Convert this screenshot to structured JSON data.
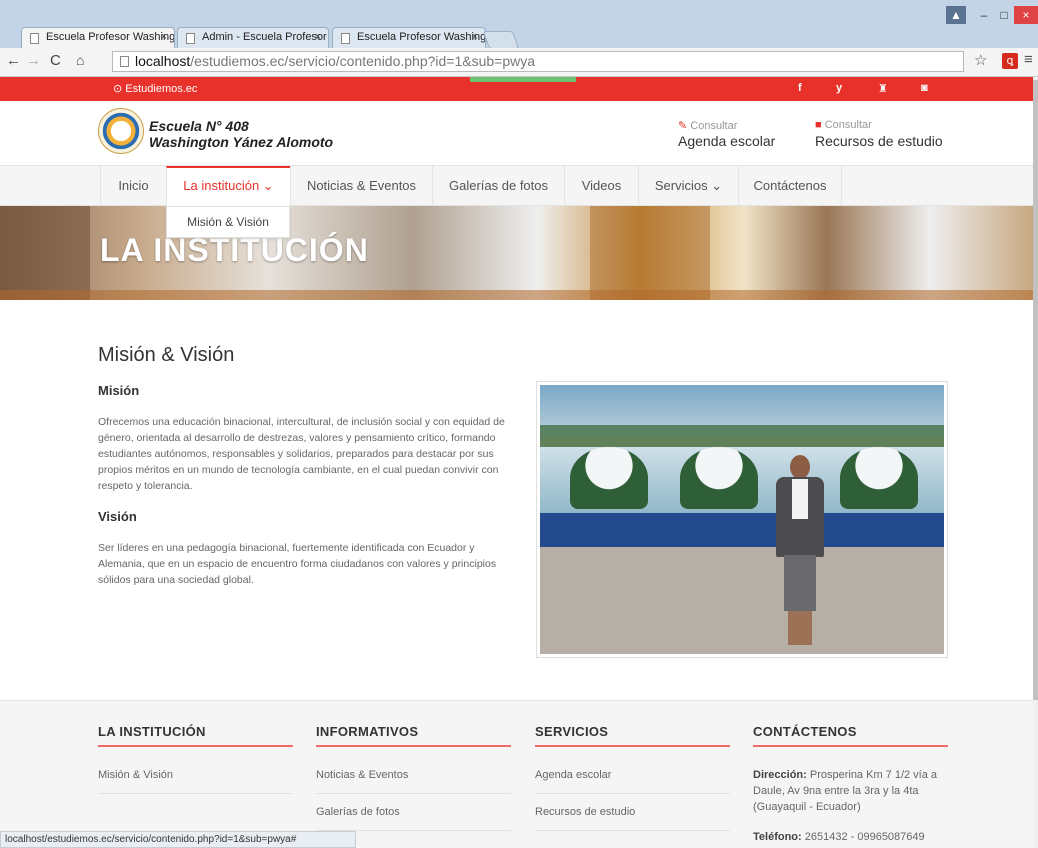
{
  "browser": {
    "tabs": [
      {
        "label": "Escuela Profesor Washing"
      },
      {
        "label": "Admin - Escuela Profesor"
      },
      {
        "label": "Escuela Profesor Washing"
      }
    ],
    "tab_close": "×",
    "url_host": "localhost",
    "url_path": "/estudiemos.ec/servicio/contenido.php?id=1&sub=pwya",
    "status_url": "localhost/estudiemos.ec/servicio/contenido.php?id=1&sub=pwya#",
    "acrobat_glyph": "ꝗ"
  },
  "topbar": {
    "brand": "Estudiemos.ec",
    "social_glyphs": [
      "f",
      "y",
      "♜",
      "◙"
    ],
    "accent_color": "#e8312a"
  },
  "header": {
    "school_line1": "Escuela N° 408",
    "school_line2": "Washington Yánez Alomoto",
    "consult1_small": "Consultar",
    "consult1_big": "Agenda escolar",
    "consult2_small": "Consultar",
    "consult2_big": "Recursos de estudio"
  },
  "nav": {
    "items": [
      {
        "label": "Inicio"
      },
      {
        "label": "La institución ⌄"
      },
      {
        "label": "Noticias & Eventos"
      },
      {
        "label": "Galerías de fotos"
      },
      {
        "label": "Videos"
      },
      {
        "label": "Servicios ⌄"
      },
      {
        "label": "Contáctenos"
      }
    ],
    "dropdown_item": "Misión & Visión"
  },
  "banner": {
    "title": "LA INSTITUCIÓN"
  },
  "main": {
    "page_title": "Misión & Visión",
    "mision_heading": "Misión",
    "mision_text": "Ofrecemos una educación binacional, intercultural, de inclusión social y con equidad de género, orientada al desarrollo de destrezas, valores y pensamiento crítico, formando estudiantes autónomos, responsables y solidarios, preparados para destacar por sus propios méritos  en un mundo de tecnología cambiante, en el cual puedan convivir con respeto y tolerancia.",
    "vision_heading": "Visión",
    "vision_text": "Ser líderes en una pedagogía binacional, fuertemente identificada con Ecuador y Alemania, que en un espacio de encuentro forma ciudadanos con valores y principios sólidos para una sociedad global."
  },
  "footer": {
    "col1": {
      "heading": "LA INSTITUCIÓN",
      "links": [
        "Misión & Visión"
      ]
    },
    "col2": {
      "heading": "INFORMATIVOS",
      "links": [
        "Noticias & Eventos",
        "Galerías de fotos"
      ]
    },
    "col3": {
      "heading": "SERVICIOS",
      "links": [
        "Agenda escolar",
        "Recursos de estudio"
      ]
    },
    "col4": {
      "heading": "CONTÁCTENOS",
      "address_label": "Dirección:",
      "address_value": " Prosperina Km 7 1/2 vía a Daule, Av 9na entre la 3ra y la 4ta (Guayaquil - Ecuador)",
      "phone_label": "Teléfono:",
      "phone_value": " 2651432 - 09965087649"
    }
  }
}
